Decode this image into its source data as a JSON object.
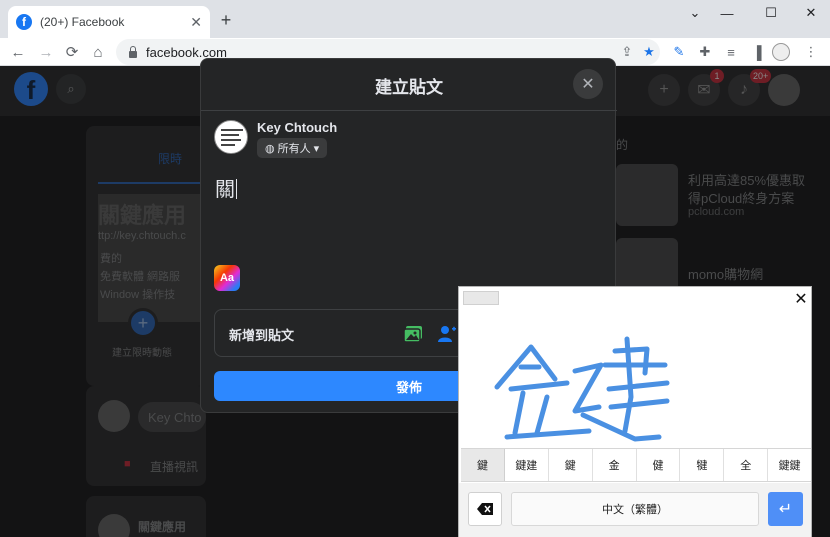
{
  "browser": {
    "tab_title": "(20+) Facebook",
    "favicon_letter": "f",
    "tab_close": "✕",
    "new_tab": "+",
    "url": "facebook.com",
    "window": {
      "minimize": "—",
      "maximize": "☐",
      "close": "✕"
    }
  },
  "facebook": {
    "logo_letter": "f",
    "badges": {
      "messenger": "1",
      "notifications": "20+"
    },
    "background": {
      "story_tab": "限時",
      "story_text_1": "關鍵應用",
      "story_text_2": "ttp://key.chtouch.c",
      "story_text_3": "費的",
      "story_text_4": "免費軟體 網路服",
      "story_text_5": "Window 操作技",
      "create_story": "建立限時動態",
      "composer_placeholder": "Key Chto",
      "live_video": "直播視訊",
      "page_name": "關鍵應用",
      "right_label": "的",
      "ad1_title_1": "利用高達85%優惠取",
      "ad1_title_2": "得pCloud終身方案",
      "ad1_domain": "pcloud.com",
      "ad2_title": "momo購物網"
    }
  },
  "dialog": {
    "title": "建立貼文",
    "user_name": "Key Chtouch",
    "audience": "所有人",
    "compose_text": "關",
    "aa_label": "Aa",
    "add_to_post": "新增到貼文",
    "post_button": "發佈"
  },
  "handwriting": {
    "candidates": [
      "鍵",
      "鍵建",
      "鍵",
      "金",
      "健",
      "犍",
      "全",
      "鍵鍵"
    ],
    "language": "中文（繁體）",
    "enter_symbol": "↵",
    "stroke_color": "#4a90e2"
  }
}
